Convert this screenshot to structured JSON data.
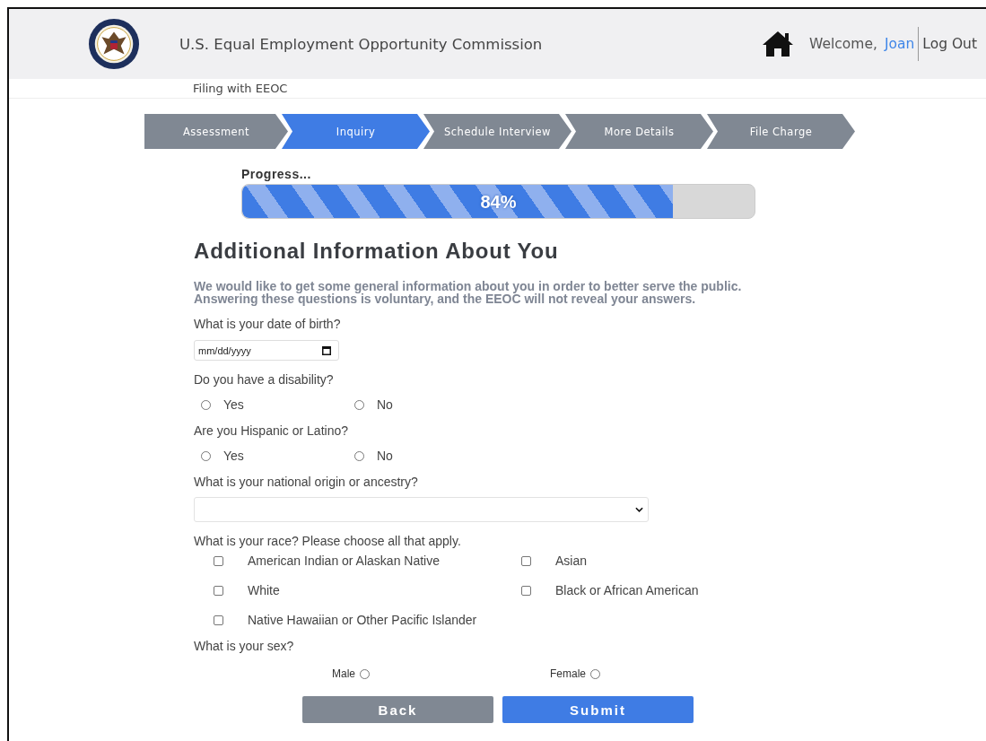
{
  "header": {
    "title": "U.S. Equal Employment Opportunity Commission",
    "welcome": "Welcome,",
    "user": "Joan",
    "logout": "Log Out"
  },
  "subheader": "Filing with EEOC",
  "steps": [
    {
      "label": "Assessment",
      "selected": false
    },
    {
      "label": "Inquiry",
      "selected": true
    },
    {
      "label": "Schedule Interview",
      "selected": false
    },
    {
      "label": "More Details",
      "selected": false
    },
    {
      "label": "File Charge",
      "selected": false
    }
  ],
  "progress": {
    "label": "Progress...",
    "level": 0.84,
    "reading": "84%"
  },
  "heading": "Additional Information About You",
  "intro": "We would like to get some general information about you in order to better serve the public. Answering these questions is voluntary, and the EEOC will not reveal your answers.",
  "questions": [
    {
      "kind": "date",
      "label": "What is your date of birth?",
      "placeholder": "mm/dd/yyyy"
    },
    {
      "kind": "radio",
      "label": "Do you have a disability?",
      "options": [
        {
          "label": "Yes",
          "selected": false
        },
        {
          "label": "No",
          "selected": false
        }
      ]
    },
    {
      "kind": "radio",
      "label": "Are you Hispanic or Latino?",
      "options": [
        {
          "label": "Yes",
          "selected": false
        },
        {
          "label": "No",
          "selected": false
        }
      ]
    },
    {
      "kind": "select",
      "label": "What is your national origin or ancestry?"
    },
    {
      "kind": "checkbox",
      "label": "What is your race? Please choose all that apply.",
      "options": [
        {
          "label": "American Indian or Alaskan Native",
          "checked": false
        },
        {
          "label": "Asian",
          "checked": false
        },
        {
          "label": "White",
          "checked": false
        },
        {
          "label": "Black or African American",
          "checked": false
        },
        {
          "label": "Native Hawaiian or Other Pacific Islander",
          "checked": false
        }
      ]
    },
    {
      "kind": "radio-after",
      "label": "What is your sex?",
      "options": [
        {
          "label": "Male",
          "selected": false
        },
        {
          "label": "Female",
          "selected": false
        }
      ]
    }
  ],
  "buttons": [
    {
      "label": "Back",
      "kind": "secondary"
    },
    {
      "label": "Submit",
      "kind": "primary"
    }
  ]
}
